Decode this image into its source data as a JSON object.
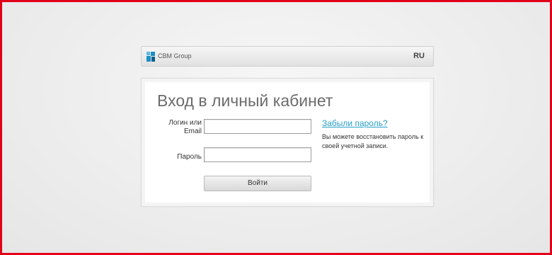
{
  "header": {
    "brand": "CBM Group",
    "language": "RU",
    "logo_colors": [
      "#1a8fc4",
      "#5fb8df",
      "#0b5f8a"
    ]
  },
  "login": {
    "title": "Вход в личный кабинет",
    "login_label": "Логин или Email",
    "login_value": "",
    "password_label": "Пароль",
    "password_value": "",
    "submit_label": "Войти",
    "forgot_link": "Забыли пароль?",
    "forgot_hint": "Вы можете восстановить пароль к своей учетной записи."
  },
  "colors": {
    "frame_border": "#e1001a",
    "link": "#2aa0c8"
  }
}
